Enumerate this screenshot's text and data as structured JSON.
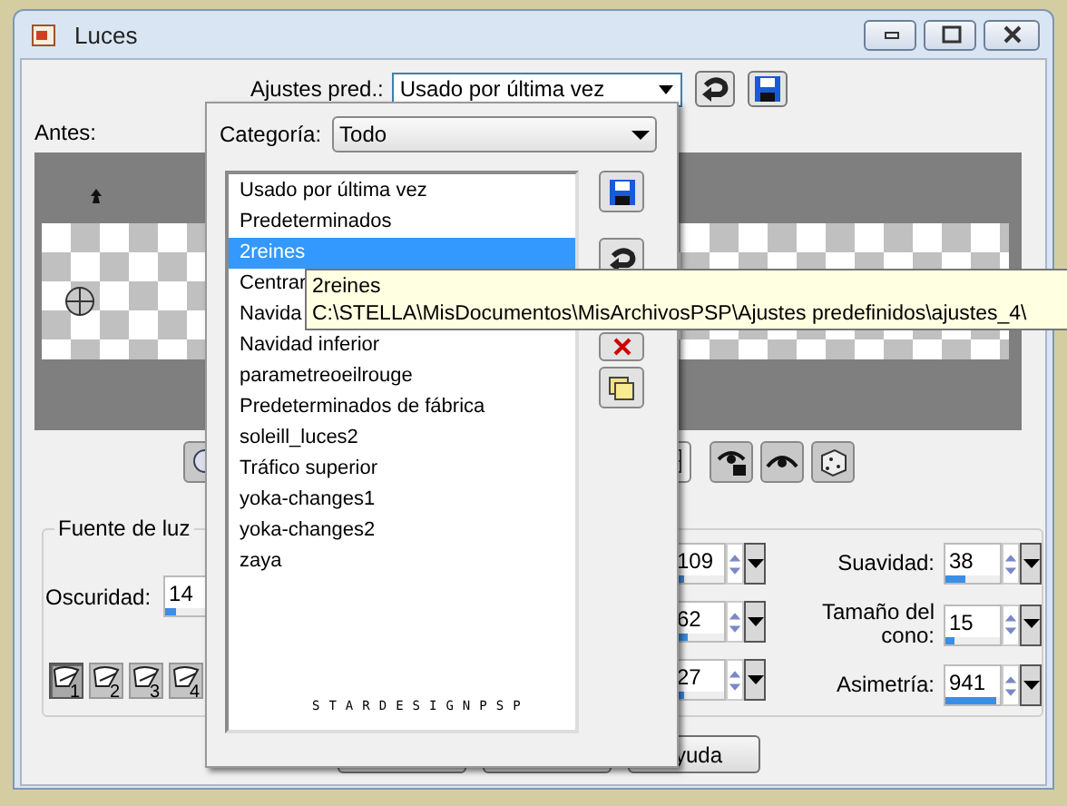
{
  "window": {
    "title": "Luces"
  },
  "presets": {
    "label": "Ajustes pred.:",
    "value": "Usado por última vez"
  },
  "preview": {
    "label": "Antes:"
  },
  "light_source": {
    "title": "Fuente de luz",
    "darkness": {
      "label": "Oscuridad:",
      "value": "14",
      "level": 0.2
    },
    "lights": [
      {
        "number": "1",
        "selected": true
      },
      {
        "number": "2",
        "selected": false
      },
      {
        "number": "3",
        "selected": false
      },
      {
        "number": "4",
        "selected": false
      }
    ],
    "partial_fields": [
      {
        "value": "109",
        "level": 0.2
      },
      {
        "value": "62",
        "level": 0.3
      },
      {
        "value": "27",
        "level": 0.23
      }
    ],
    "fields": [
      {
        "label": "Suavidad:",
        "value": "38",
        "level": 0.38
      },
      {
        "label": "Tamaño del cono:",
        "value": "15",
        "level": 0.15
      },
      {
        "label": "Asimetría:",
        "value": "941",
        "level": 0.94
      }
    ]
  },
  "help_button": {
    "label": "yuda"
  },
  "preset_popup": {
    "category_label": "Categoría:",
    "category": "Todo",
    "items": [
      {
        "label": "Usado por última vez",
        "selected": false
      },
      {
        "label": "Predeterminados",
        "selected": false
      },
      {
        "label": "2reines",
        "selected": true
      },
      {
        "label": "Centrar",
        "selected": false
      },
      {
        "label": "Navida",
        "selected": false
      },
      {
        "label": "Navidad inferior",
        "selected": false
      },
      {
        "label": "parametreoeilrouge",
        "selected": false
      },
      {
        "label": "Predeterminados de fábrica",
        "selected": false
      },
      {
        "label": "soleill_luces2",
        "selected": false
      },
      {
        "label": "Tráfico superior",
        "selected": false
      },
      {
        "label": "yoka-changes1",
        "selected": false
      },
      {
        "label": "yoka-changes2",
        "selected": false
      },
      {
        "label": "zaya",
        "selected": false
      }
    ],
    "logo": "STARDESIGNPSP"
  },
  "tooltip": {
    "title": "2reines",
    "path": "C:\\STELLA\\MisDocumentos\\MisArchivosPSP\\Ajustes predefinidos\\ajustes_4\\"
  }
}
